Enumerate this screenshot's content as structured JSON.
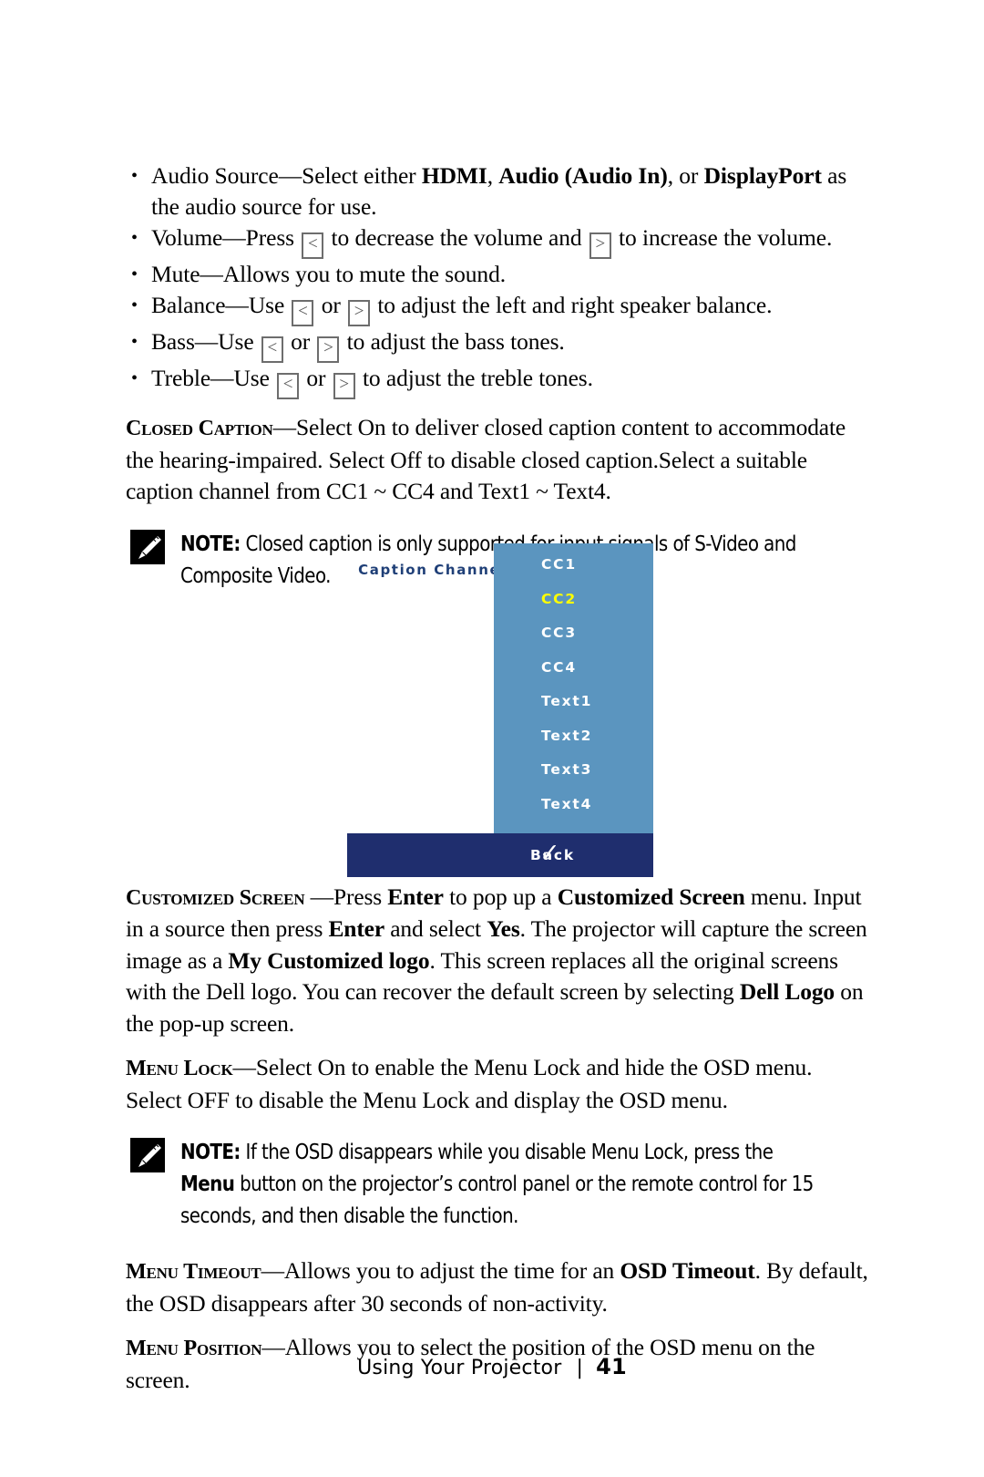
{
  "page": {
    "footer_label": "Using Your Projector",
    "footer_separator": "|",
    "page_number": "41"
  },
  "bullets": [
    {
      "name": "audio-source",
      "parts": [
        {
          "t": "Audio Source",
          "style": "normal"
        },
        {
          "t": "—Select either ",
          "style": "normal"
        },
        {
          "t": "HDMI",
          "style": "bold"
        },
        {
          "t": ", ",
          "style": "normal"
        },
        {
          "t": "Audio (Audio In)",
          "style": "bold"
        },
        {
          "t": ", or ",
          "style": "normal"
        },
        {
          "t": "DisplayPort",
          "style": "bold"
        },
        {
          "t": " as the audio source for use.",
          "style": "normal"
        }
      ]
    },
    {
      "name": "volume",
      "parts": [
        {
          "t": "Volume—Press ",
          "style": "normal"
        },
        {
          "t": "<",
          "style": "key"
        },
        {
          "t": " to decrease the volume and ",
          "style": "normal"
        },
        {
          "t": ">",
          "style": "key"
        },
        {
          "t": " to increase the volume.",
          "style": "normal"
        }
      ]
    },
    {
      "name": "mute",
      "parts": [
        {
          "t": "Mute—Allows you to mute the sound.",
          "style": "normal"
        }
      ]
    },
    {
      "name": "balance",
      "parts": [
        {
          "t": "Balance—Use ",
          "style": "normal"
        },
        {
          "t": "<",
          "style": "key"
        },
        {
          "t": " or ",
          "style": "normal"
        },
        {
          "t": ">",
          "style": "key"
        },
        {
          "t": " to adjust the left and right speaker balance.",
          "style": "normal"
        }
      ]
    },
    {
      "name": "bass",
      "parts": [
        {
          "t": "Bass—Use ",
          "style": "normal"
        },
        {
          "t": "<",
          "style": "key"
        },
        {
          "t": " or ",
          "style": "normal"
        },
        {
          "t": ">",
          "style": "key"
        },
        {
          "t": " to adjust the bass tones.",
          "style": "normal"
        }
      ]
    },
    {
      "name": "treble",
      "parts": [
        {
          "t": "Treble—Use ",
          "style": "normal"
        },
        {
          "t": "<",
          "style": "key"
        },
        {
          "t": " or ",
          "style": "normal"
        },
        {
          "t": ">",
          "style": "key"
        },
        {
          "t": " to adjust the treble tones.",
          "style": "normal"
        }
      ]
    }
  ],
  "closed_caption": {
    "heading": "Closed Caption",
    "body_1": "—Select ",
    "on": "On",
    "body_2": " to deliver closed caption content to accommodate the hearing-impaired. Select ",
    "off": "Off",
    "body_3": " to disable closed caption.Select a suitable caption channel from CC1 ~ CC4 and Text1 ~ Text4."
  },
  "note_1": {
    "icon": "note-pencil-icon",
    "label": "NOTE:",
    "text": " Closed caption is only supported for input signals of S-Video and Composite Video."
  },
  "osd": {
    "label": "Caption Channel",
    "panel_color": "#5b95bf",
    "back_bar_color": "#1f2e6e",
    "label_color": "#1f3f77",
    "selected_color": "#ffff00",
    "items": [
      {
        "label": "CC1",
        "selected": false
      },
      {
        "label": "CC2",
        "selected": true
      },
      {
        "label": "CC3",
        "selected": false
      },
      {
        "label": "CC4",
        "selected": false
      },
      {
        "label": "Text1",
        "selected": false
      },
      {
        "label": "Text2",
        "selected": false
      },
      {
        "label": "Text3",
        "selected": false
      },
      {
        "label": "Text4",
        "selected": false
      }
    ],
    "back_label": "Back",
    "confirm_icon": "checkmark-icon"
  },
  "customized_screen": {
    "heading": "Customized Screen",
    "body_1": " —Press ",
    "enter_1": "Enter",
    "body_2": " to pop up a ",
    "menu_name": "Customized Screen",
    "body_3": " menu. Input in a source then press ",
    "enter_2": "Enter",
    "body_4": " and select ",
    "yes": "Yes",
    "body_5": ". The projector will capture the screen image as a ",
    "logo_name": "My Customized logo",
    "body_6": ". This screen replaces all the original screens with the Dell logo. You can recover the default screen by selecting ",
    "dell_logo": "Dell Logo",
    "body_7": " on the pop-up screen."
  },
  "menu_lock": {
    "heading": "Menu Lock",
    "body_1": "—Select ",
    "on": "On",
    "body_2": " to enable the Menu Lock and hide the OSD menu. Select OFF to disable the Menu Lock and display the OSD menu."
  },
  "note_2": {
    "icon": "note-pencil-icon",
    "label": "NOTE:",
    "text_1": " If the OSD disappears while you disable Menu Lock, press the ",
    "menu_bold": "Menu",
    "text_2": " button on the projector’s control panel or the remote control for 15 seconds, and then disable the function."
  },
  "menu_timeout": {
    "heading": "Menu Timeout",
    "body_1": "—Allows you to adjust the time for an ",
    "osd_timeout": "OSD Timeout",
    "body_2": ". By default, the OSD disappears after 30 seconds of non-activity."
  },
  "menu_position": {
    "heading": "Menu Position",
    "body": "—Allows you to select the position of the OSD menu on the screen."
  }
}
